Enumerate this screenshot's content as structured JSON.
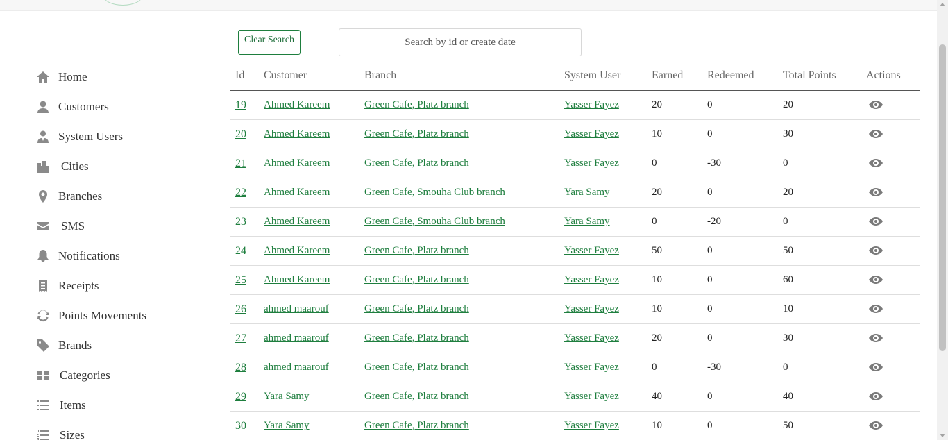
{
  "sidebar": {
    "items": [
      {
        "label": "Home",
        "icon": "home-icon"
      },
      {
        "label": "Customers",
        "icon": "user-icon"
      },
      {
        "label": "System Users",
        "icon": "user-tie-icon"
      },
      {
        "label": "Cities",
        "icon": "city-icon"
      },
      {
        "label": "Branches",
        "icon": "map-marker-icon"
      },
      {
        "label": "SMS",
        "icon": "envelope-icon"
      },
      {
        "label": "Notifications",
        "icon": "bell-icon"
      },
      {
        "label": "Receipts",
        "icon": "receipt-icon"
      },
      {
        "label": "Points Movements",
        "icon": "sync-icon"
      },
      {
        "label": "Brands",
        "icon": "tag-icon"
      },
      {
        "label": "Categories",
        "icon": "grid-icon"
      },
      {
        "label": "Items",
        "icon": "list-icon"
      },
      {
        "label": "Sizes",
        "icon": "list-ol-icon"
      }
    ]
  },
  "toolbar": {
    "clear_label": "Clear Search",
    "search_placeholder": "Search by id or create date"
  },
  "table": {
    "headers": [
      "Id",
      "Customer",
      "Branch",
      "System User",
      "Earned",
      "Redeemed",
      "Total Points",
      "Actions"
    ],
    "rows": [
      {
        "id": "19",
        "customer": "Ahmed Kareem",
        "branch": "Green Cafe, Platz branch",
        "user": "Yasser Fayez",
        "earned": "20",
        "redeemed": "0",
        "total": "20"
      },
      {
        "id": "20",
        "customer": "Ahmed Kareem",
        "branch": "Green Cafe, Platz branch",
        "user": "Yasser Fayez",
        "earned": "10",
        "redeemed": "0",
        "total": "30"
      },
      {
        "id": "21",
        "customer": "Ahmed Kareem",
        "branch": "Green Cafe, Platz branch",
        "user": "Yasser Fayez",
        "earned": "0",
        "redeemed": "-30",
        "total": "0"
      },
      {
        "id": "22",
        "customer": "Ahmed Kareem",
        "branch": "Green Cafe, Smouha Club branch",
        "user": "Yara Samy",
        "earned": "20",
        "redeemed": "0",
        "total": "20"
      },
      {
        "id": "23",
        "customer": "Ahmed Kareem",
        "branch": "Green Cafe, Smouha Club branch",
        "user": "Yara Samy",
        "earned": "0",
        "redeemed": "-20",
        "total": "0"
      },
      {
        "id": "24",
        "customer": "Ahmed Kareem",
        "branch": "Green Cafe, Platz branch",
        "user": "Yasser Fayez",
        "earned": "50",
        "redeemed": "0",
        "total": "50"
      },
      {
        "id": "25",
        "customer": "Ahmed Kareem",
        "branch": "Green Cafe, Platz branch",
        "user": "Yasser Fayez",
        "earned": "10",
        "redeemed": "0",
        "total": "60"
      },
      {
        "id": "26",
        "customer": "ahmed maarouf",
        "branch": "Green Cafe, Platz branch",
        "user": "Yasser Fayez",
        "earned": "10",
        "redeemed": "0",
        "total": "10"
      },
      {
        "id": "27",
        "customer": "ahmed maarouf",
        "branch": "Green Cafe, Platz branch",
        "user": "Yasser Fayez",
        "earned": "20",
        "redeemed": "0",
        "total": "30"
      },
      {
        "id": "28",
        "customer": "ahmed maarouf",
        "branch": "Green Cafe, Platz branch",
        "user": "Yasser Fayez",
        "earned": "0",
        "redeemed": "-30",
        "total": "0"
      },
      {
        "id": "29",
        "customer": "Yara Samy",
        "branch": "Green Cafe, Platz branch",
        "user": "Yasser Fayez",
        "earned": "40",
        "redeemed": "0",
        "total": "40"
      },
      {
        "id": "30",
        "customer": "Yara Samy",
        "branch": "Green Cafe, Platz branch",
        "user": "Yasser Fayez",
        "earned": "10",
        "redeemed": "0",
        "total": "50"
      }
    ]
  },
  "colors": {
    "link": "#1e7e3e",
    "icon": "#8a8a8a"
  }
}
